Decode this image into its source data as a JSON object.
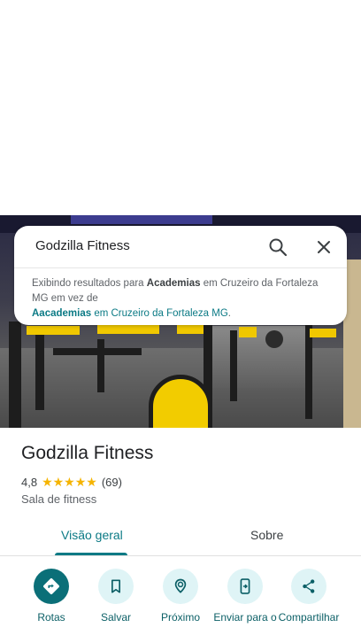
{
  "search": {
    "query": "Godzilla Fitness",
    "notice_prefix": "Exibindo resultados para ",
    "notice_term": "Academias",
    "notice_middle": " em Cruzeiro da Fortaleza MG em vez de",
    "suggest_term": "Aacademias",
    "suggest_suffix": " em Cruzeiro da Fortaleza MG",
    "suggest_end": "."
  },
  "place": {
    "name": "Godzilla Fitness",
    "rating": "4,8",
    "stars": "★★★★★",
    "reviews": "(69)",
    "category": "Sala de fitness"
  },
  "tabs": {
    "overview": "Visão geral",
    "about": "Sobre"
  },
  "actions": {
    "directions": "Rotas",
    "save": "Salvar",
    "nearby": "Próximo",
    "send": "Enviar para o",
    "share": "Compartilhar"
  },
  "colors": {
    "accent": "#0b7a85",
    "star": "#f5b400",
    "action_bg": "#dff4f6"
  }
}
